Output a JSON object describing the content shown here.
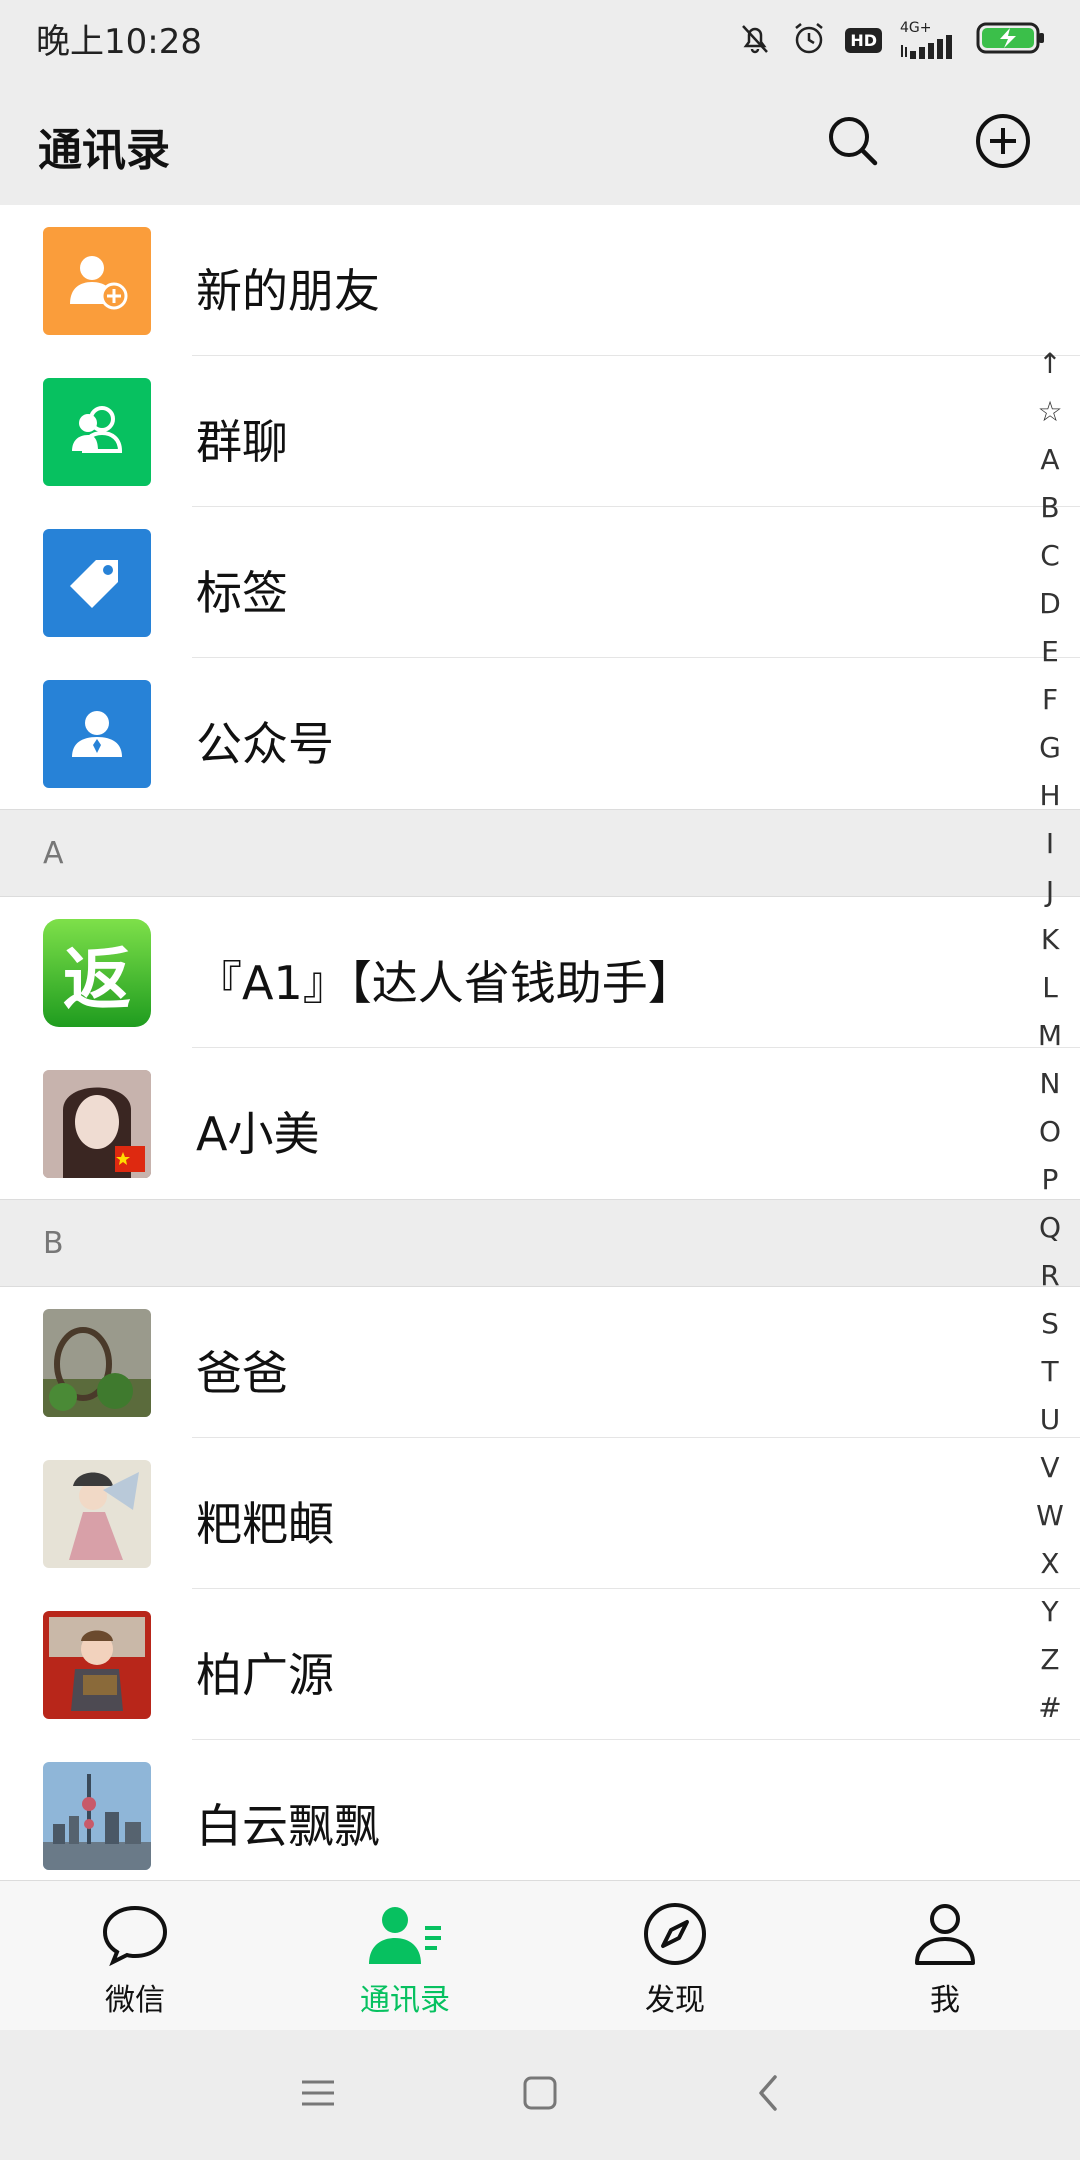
{
  "status": {
    "time": "晚上10:28",
    "hd": "HD",
    "network": "4G+",
    "icons": [
      "mute-bell-icon",
      "alarm-icon",
      "hd-icon",
      "signal-icon",
      "battery-charging-icon"
    ]
  },
  "header": {
    "title": "通讯录",
    "icons": [
      "search-icon",
      "add-circle-icon"
    ]
  },
  "top_items": [
    {
      "label": "新的朋友",
      "icon": "add-friend-icon",
      "color": "#fa9d3b"
    },
    {
      "label": "群聊",
      "icon": "group-chat-icon",
      "color": "#07c160"
    },
    {
      "label": "标签",
      "icon": "tag-icon",
      "color": "#2782d7"
    },
    {
      "label": "公众号",
      "icon": "official-account-icon",
      "color": "#2782d7"
    }
  ],
  "sections": [
    {
      "letter": "A",
      "contacts": [
        {
          "name": "『A1』【达人省钱助手】",
          "avatar": "fan-green-badge",
          "avatar_text": "返"
        },
        {
          "name": "A小美",
          "avatar": "photo-woman"
        }
      ]
    },
    {
      "letter": "B",
      "contacts": [
        {
          "name": "爸爸",
          "avatar": "photo-plants"
        },
        {
          "name": "粑粑頔",
          "avatar": "photo-illustration"
        },
        {
          "name": "柏广源",
          "avatar": "photo-child-red-chair"
        },
        {
          "name": "白云飘飘",
          "avatar": "photo-city-skyline"
        }
      ]
    }
  ],
  "index_letters": [
    "↑",
    "☆",
    "A",
    "B",
    "C",
    "D",
    "E",
    "F",
    "G",
    "H",
    "I",
    "J",
    "K",
    "L",
    "M",
    "N",
    "O",
    "P",
    "Q",
    "R",
    "S",
    "T",
    "U",
    "V",
    "W",
    "X",
    "Y",
    "Z",
    "#"
  ],
  "tabbar": [
    {
      "label": "微信",
      "icon": "chat-bubble-icon",
      "active": false
    },
    {
      "label": "通讯录",
      "icon": "contacts-icon",
      "active": true
    },
    {
      "label": "发现",
      "icon": "compass-icon",
      "active": false
    },
    {
      "label": "我",
      "icon": "person-icon",
      "active": false
    }
  ],
  "navbar": [
    "menu-icon",
    "home-square-icon",
    "back-icon"
  ],
  "colors": {
    "accent": "#07c160",
    "background": "#ededed"
  }
}
